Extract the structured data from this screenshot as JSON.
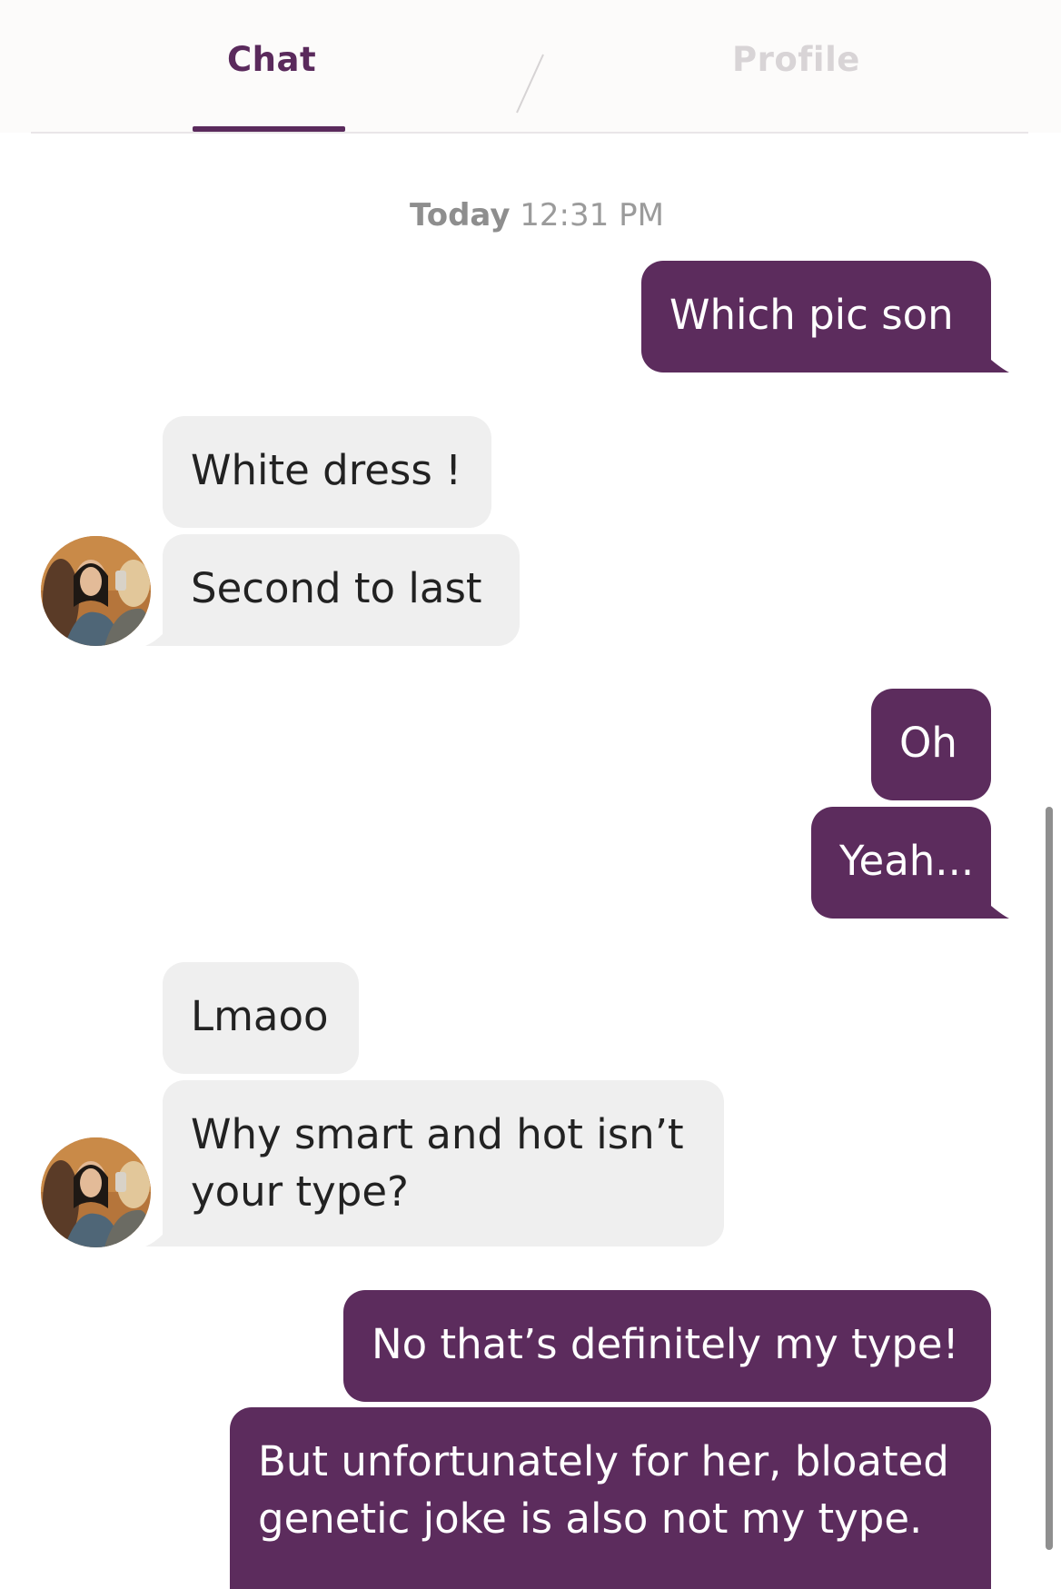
{
  "tabs": {
    "chat_label": "Chat",
    "profile_label": "Profile"
  },
  "timestamp": {
    "day": "Today",
    "time": "12:31 PM"
  },
  "messages": [
    {
      "from": "me",
      "text": "Which pic son"
    },
    {
      "from": "them",
      "text": "White dress !"
    },
    {
      "from": "them",
      "text": "Second to last"
    },
    {
      "from": "me",
      "text": "Oh"
    },
    {
      "from": "me",
      "text": "Yeah..."
    },
    {
      "from": "them",
      "text": "Lmaoo"
    },
    {
      "from": "them",
      "text": "Why smart and hot isn’t your type?"
    },
    {
      "from": "me",
      "text": "No that’s definitely my type!"
    },
    {
      "from": "me",
      "text": "But unfortunately for her, bloated genetic joke is also not my type."
    }
  ],
  "colors": {
    "accent": "#5c2c5d",
    "incoming_bubble": "#efefef",
    "tab_inactive": "#d8d4d6"
  }
}
